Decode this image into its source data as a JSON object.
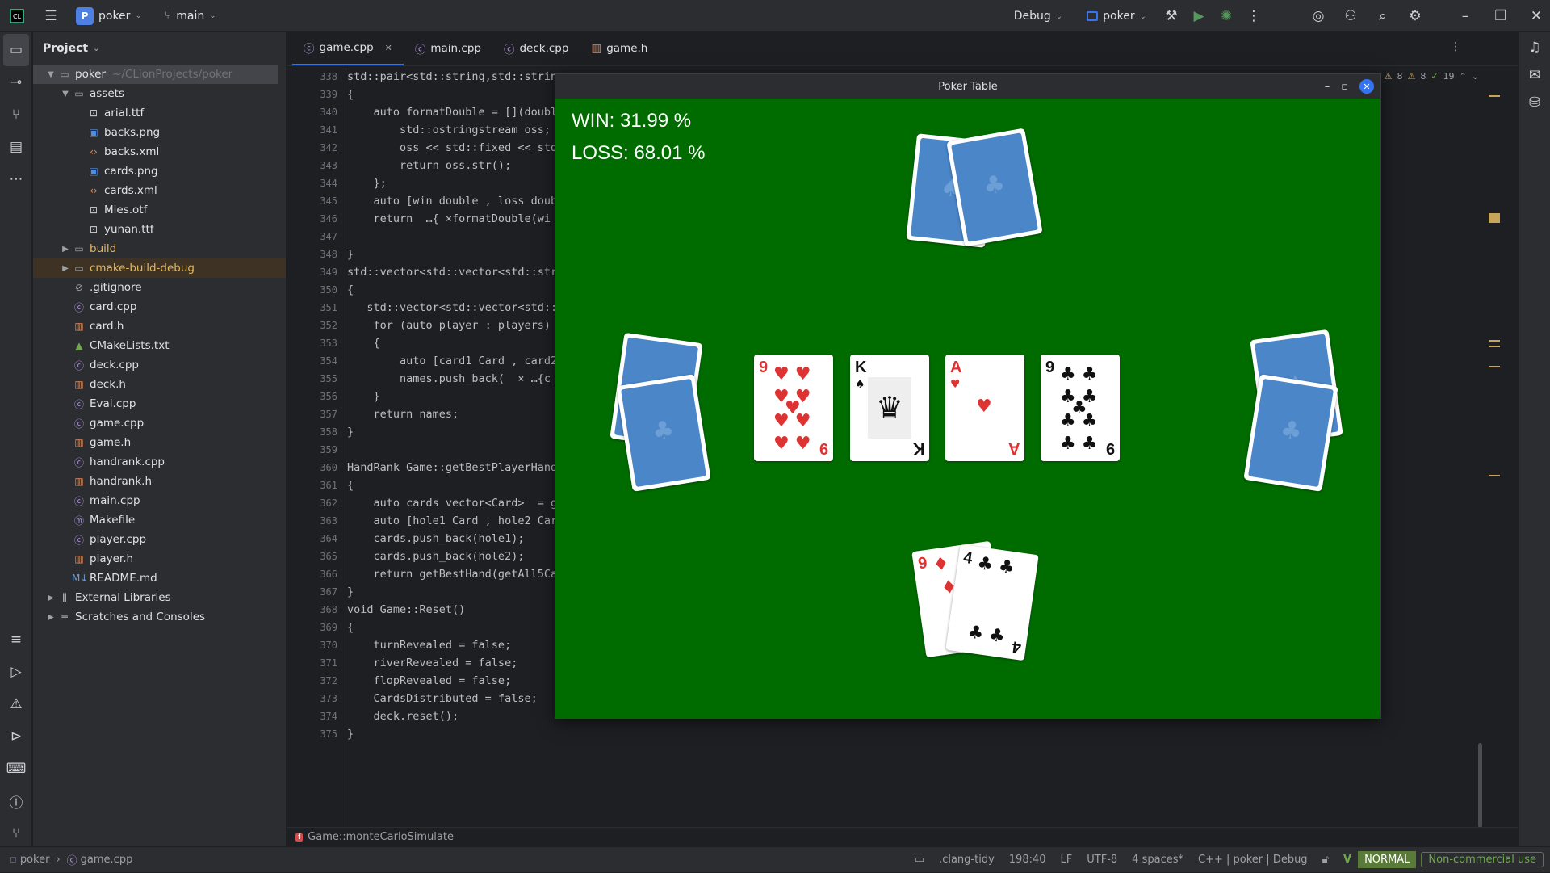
{
  "titlebar": {
    "project": "poker",
    "project_badge": "P",
    "branch": "main",
    "config": "Debug",
    "run_target": "poker"
  },
  "project_panel": {
    "title": "Project",
    "root": "poker",
    "root_path": "~/CLionProjects/poker",
    "items": [
      {
        "label": "assets",
        "kind": "folder"
      },
      {
        "label": "arial.ttf",
        "kind": "font"
      },
      {
        "label": "backs.png",
        "kind": "image"
      },
      {
        "label": "backs.xml",
        "kind": "xml"
      },
      {
        "label": "cards.png",
        "kind": "image"
      },
      {
        "label": "cards.xml",
        "kind": "xml"
      },
      {
        "label": "Mies.otf",
        "kind": "font"
      },
      {
        "label": "yunan.ttf",
        "kind": "font"
      },
      {
        "label": "build",
        "kind": "folder"
      },
      {
        "label": "cmake-build-debug",
        "kind": "folder"
      },
      {
        "label": ".gitignore",
        "kind": "ignore"
      },
      {
        "label": "card.cpp",
        "kind": "cpp"
      },
      {
        "label": "card.h",
        "kind": "h"
      },
      {
        "label": "CMakeLists.txt",
        "kind": "cmake"
      },
      {
        "label": "deck.cpp",
        "kind": "cpp"
      },
      {
        "label": "deck.h",
        "kind": "h"
      },
      {
        "label": "Eval.cpp",
        "kind": "cpp"
      },
      {
        "label": "game.cpp",
        "kind": "cpp"
      },
      {
        "label": "game.h",
        "kind": "h"
      },
      {
        "label": "handrank.cpp",
        "kind": "cpp"
      },
      {
        "label": "handrank.h",
        "kind": "h"
      },
      {
        "label": "main.cpp",
        "kind": "cpp"
      },
      {
        "label": "Makefile",
        "kind": "make"
      },
      {
        "label": "player.cpp",
        "kind": "cpp"
      },
      {
        "label": "player.h",
        "kind": "h"
      },
      {
        "label": "README.md",
        "kind": "md"
      },
      {
        "label": "External Libraries",
        "kind": "lib"
      },
      {
        "label": "Scratches and Consoles",
        "kind": "scratch"
      }
    ]
  },
  "tabs": [
    "game.cpp",
    "main.cpp",
    "deck.cpp",
    "game.h"
  ],
  "inspections": {
    "warn1": "8",
    "warn2": "8",
    "ok": "19"
  },
  "line_numbers": [
    "338",
    "339",
    "340",
    "341",
    "342",
    "343",
    "344",
    "345",
    "346",
    "347",
    "348",
    "349",
    "350",
    "351",
    "352",
    "353",
    "354",
    "355",
    "356",
    "357",
    "358",
    "359",
    "360",
    "361",
    "362",
    "363",
    "364",
    "365",
    "366",
    "367",
    "368",
    "369",
    "370",
    "371",
    "372",
    "373",
    "374",
    "375"
  ],
  "code_lines": [
    "std::pair<std::string,std::strin",
    "{",
    "    auto formatDouble = [](doubl",
    "        std::ostringstream oss;",
    "        oss << std::fixed << std",
    "        return oss.str();",
    "    };",
    "    auto [win double , loss double ]",
    "    return  …{ ×formatDouble(wi",
    "",
    "}",
    "std::vector<std::vector<std::str",
    "{",
    "   std::vector<std::vector<std::",
    "    for (auto player : players)",
    "    {",
    "        auto [card1 Card , card2",
    "        names.push_back(  × …{c",
    "    }",
    "    return names;",
    "}",
    "",
    "HandRank Game::getBestPlayerHand",
    "{",
    "    auto cards vector<Card>  = getC",
    "    auto [hole1 Card , hole2 Car",
    "    cards.push_back(hole1);",
    "    cards.push_back(hole2);",
    "    return getBestHand(getAll5Ca",
    "}",
    "void Game::Reset()",
    "{",
    "    turnRevealed = false;",
    "    riverRevealed = false;",
    "    flopRevealed = false;",
    "    CardsDistributed = false;",
    "    deck.reset();",
    "}"
  ],
  "breadcrumb": "Game::monteCarloSimulate",
  "status": {
    "project": "poker",
    "file": "game.cpp",
    "lint": ".clang-tidy",
    "position": "198:40",
    "line_ending": "LF",
    "encoding": "UTF-8",
    "indent": "4 spaces*",
    "lang": "C++",
    "context": "poker",
    "config": "Debug",
    "vim_mode": "NORMAL",
    "license": "Non-commercial use"
  },
  "game": {
    "title": "Poker Table",
    "win": "WIN: 31.99 %",
    "loss": "LOSS: 68.01 %",
    "community": [
      {
        "rank": "9",
        "suit": "♥",
        "color": "red"
      },
      {
        "rank": "K",
        "suit": "♠",
        "color": "black"
      },
      {
        "rank": "A",
        "suit": "♥",
        "color": "red"
      },
      {
        "rank": "9",
        "suit": "♣",
        "color": "black"
      }
    ],
    "hand": [
      {
        "rank": "9",
        "suit": "♦",
        "color": "red"
      },
      {
        "rank": "4",
        "suit": "♣",
        "color": "black"
      }
    ]
  }
}
